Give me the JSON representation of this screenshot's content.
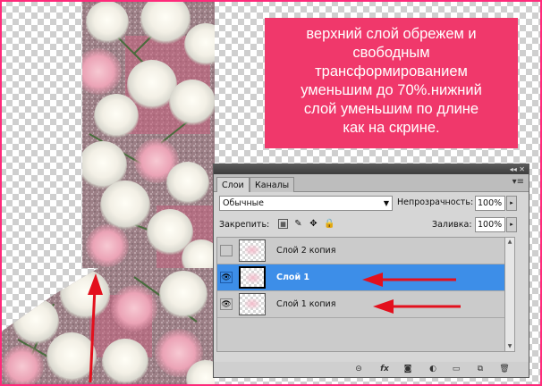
{
  "callout": {
    "lines": [
      "верхний слой обрежем и",
      "свободным",
      "трансформированием",
      "уменьшим до 70%.нижний",
      "слой уменьшим по длине",
      "как на скрине."
    ]
  },
  "panel": {
    "tabs": [
      "Слои",
      "Каналы"
    ],
    "blend_mode": "Обычные",
    "opacity_label": "Непрозрачность:",
    "opacity_value": "100%",
    "lock_label": "Закрепить:",
    "fill_label": "Заливка:",
    "fill_value": "100%",
    "layers": [
      {
        "name": "Слой 2 копия",
        "visible": false,
        "selected": false
      },
      {
        "name": "Слой 1",
        "visible": true,
        "selected": true
      },
      {
        "name": "Слой 1 копия",
        "visible": true,
        "selected": false
      }
    ]
  },
  "colors": {
    "frame": "#ff2a7a",
    "callout_bg": "#f0386b",
    "selected_layer": "#3d8ee8",
    "arrow": "#e3101d"
  }
}
